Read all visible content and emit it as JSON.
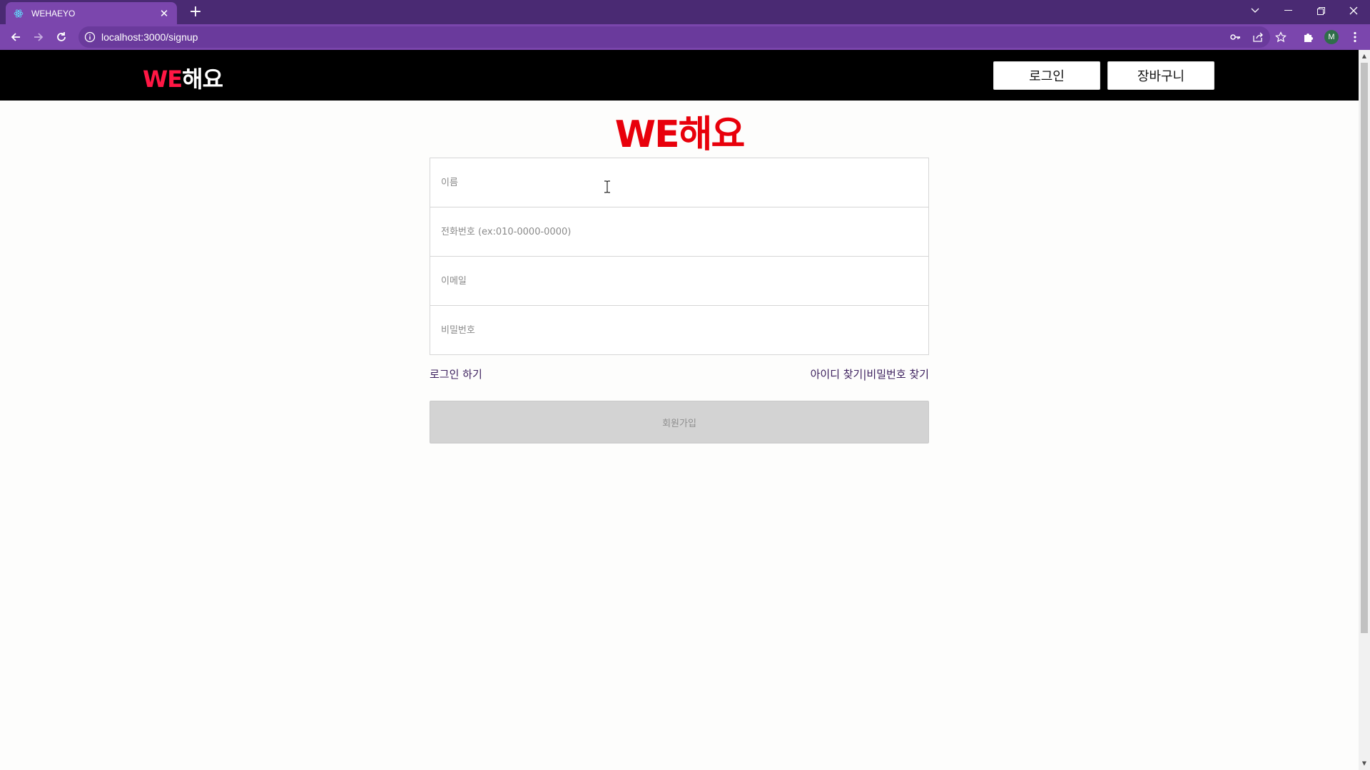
{
  "browser": {
    "tab_title": "WEHAEYO",
    "tab_close": "✕",
    "new_tab": "+",
    "url": "localhost:3000/signup",
    "avatar_initial": "M",
    "window_controls": {
      "dropdown": "⌄",
      "minimize": "—",
      "restore": "❐",
      "close": "✕"
    }
  },
  "header": {
    "logo_we": "WE",
    "logo_rest": "해요",
    "login_button": "로그인",
    "cart_button": "장바구니"
  },
  "main": {
    "logo_big": "WE해요",
    "fields": {
      "name_placeholder": "이름",
      "phone_placeholder": "전화번호 (ex:010-0000-0000)",
      "email_placeholder": "이메일",
      "password_placeholder": "비밀번호"
    },
    "login_link": "로그인 하기",
    "find_links": "아이디 찾기|비밀번호 찾기",
    "submit_label": "회원가입"
  },
  "colors": {
    "tabstrip": "#4a2a73",
    "toolbar": "#7b46ad",
    "header_bg": "#000000",
    "logo_accent": "#ff1744",
    "big_logo": "#e8000b",
    "submit_disabled": "#d3d3d3"
  },
  "icons": {
    "favicon": "react-atom-icon",
    "back": "arrow-left-icon",
    "forward": "arrow-right-icon",
    "reload": "reload-icon",
    "site_info": "info-icon",
    "password_key": "key-icon",
    "share": "share-icon",
    "bookmark": "star-icon",
    "extensions": "puzzle-icon",
    "menu": "kebab-menu-icon",
    "text_cursor": "i-beam-cursor-icon"
  }
}
